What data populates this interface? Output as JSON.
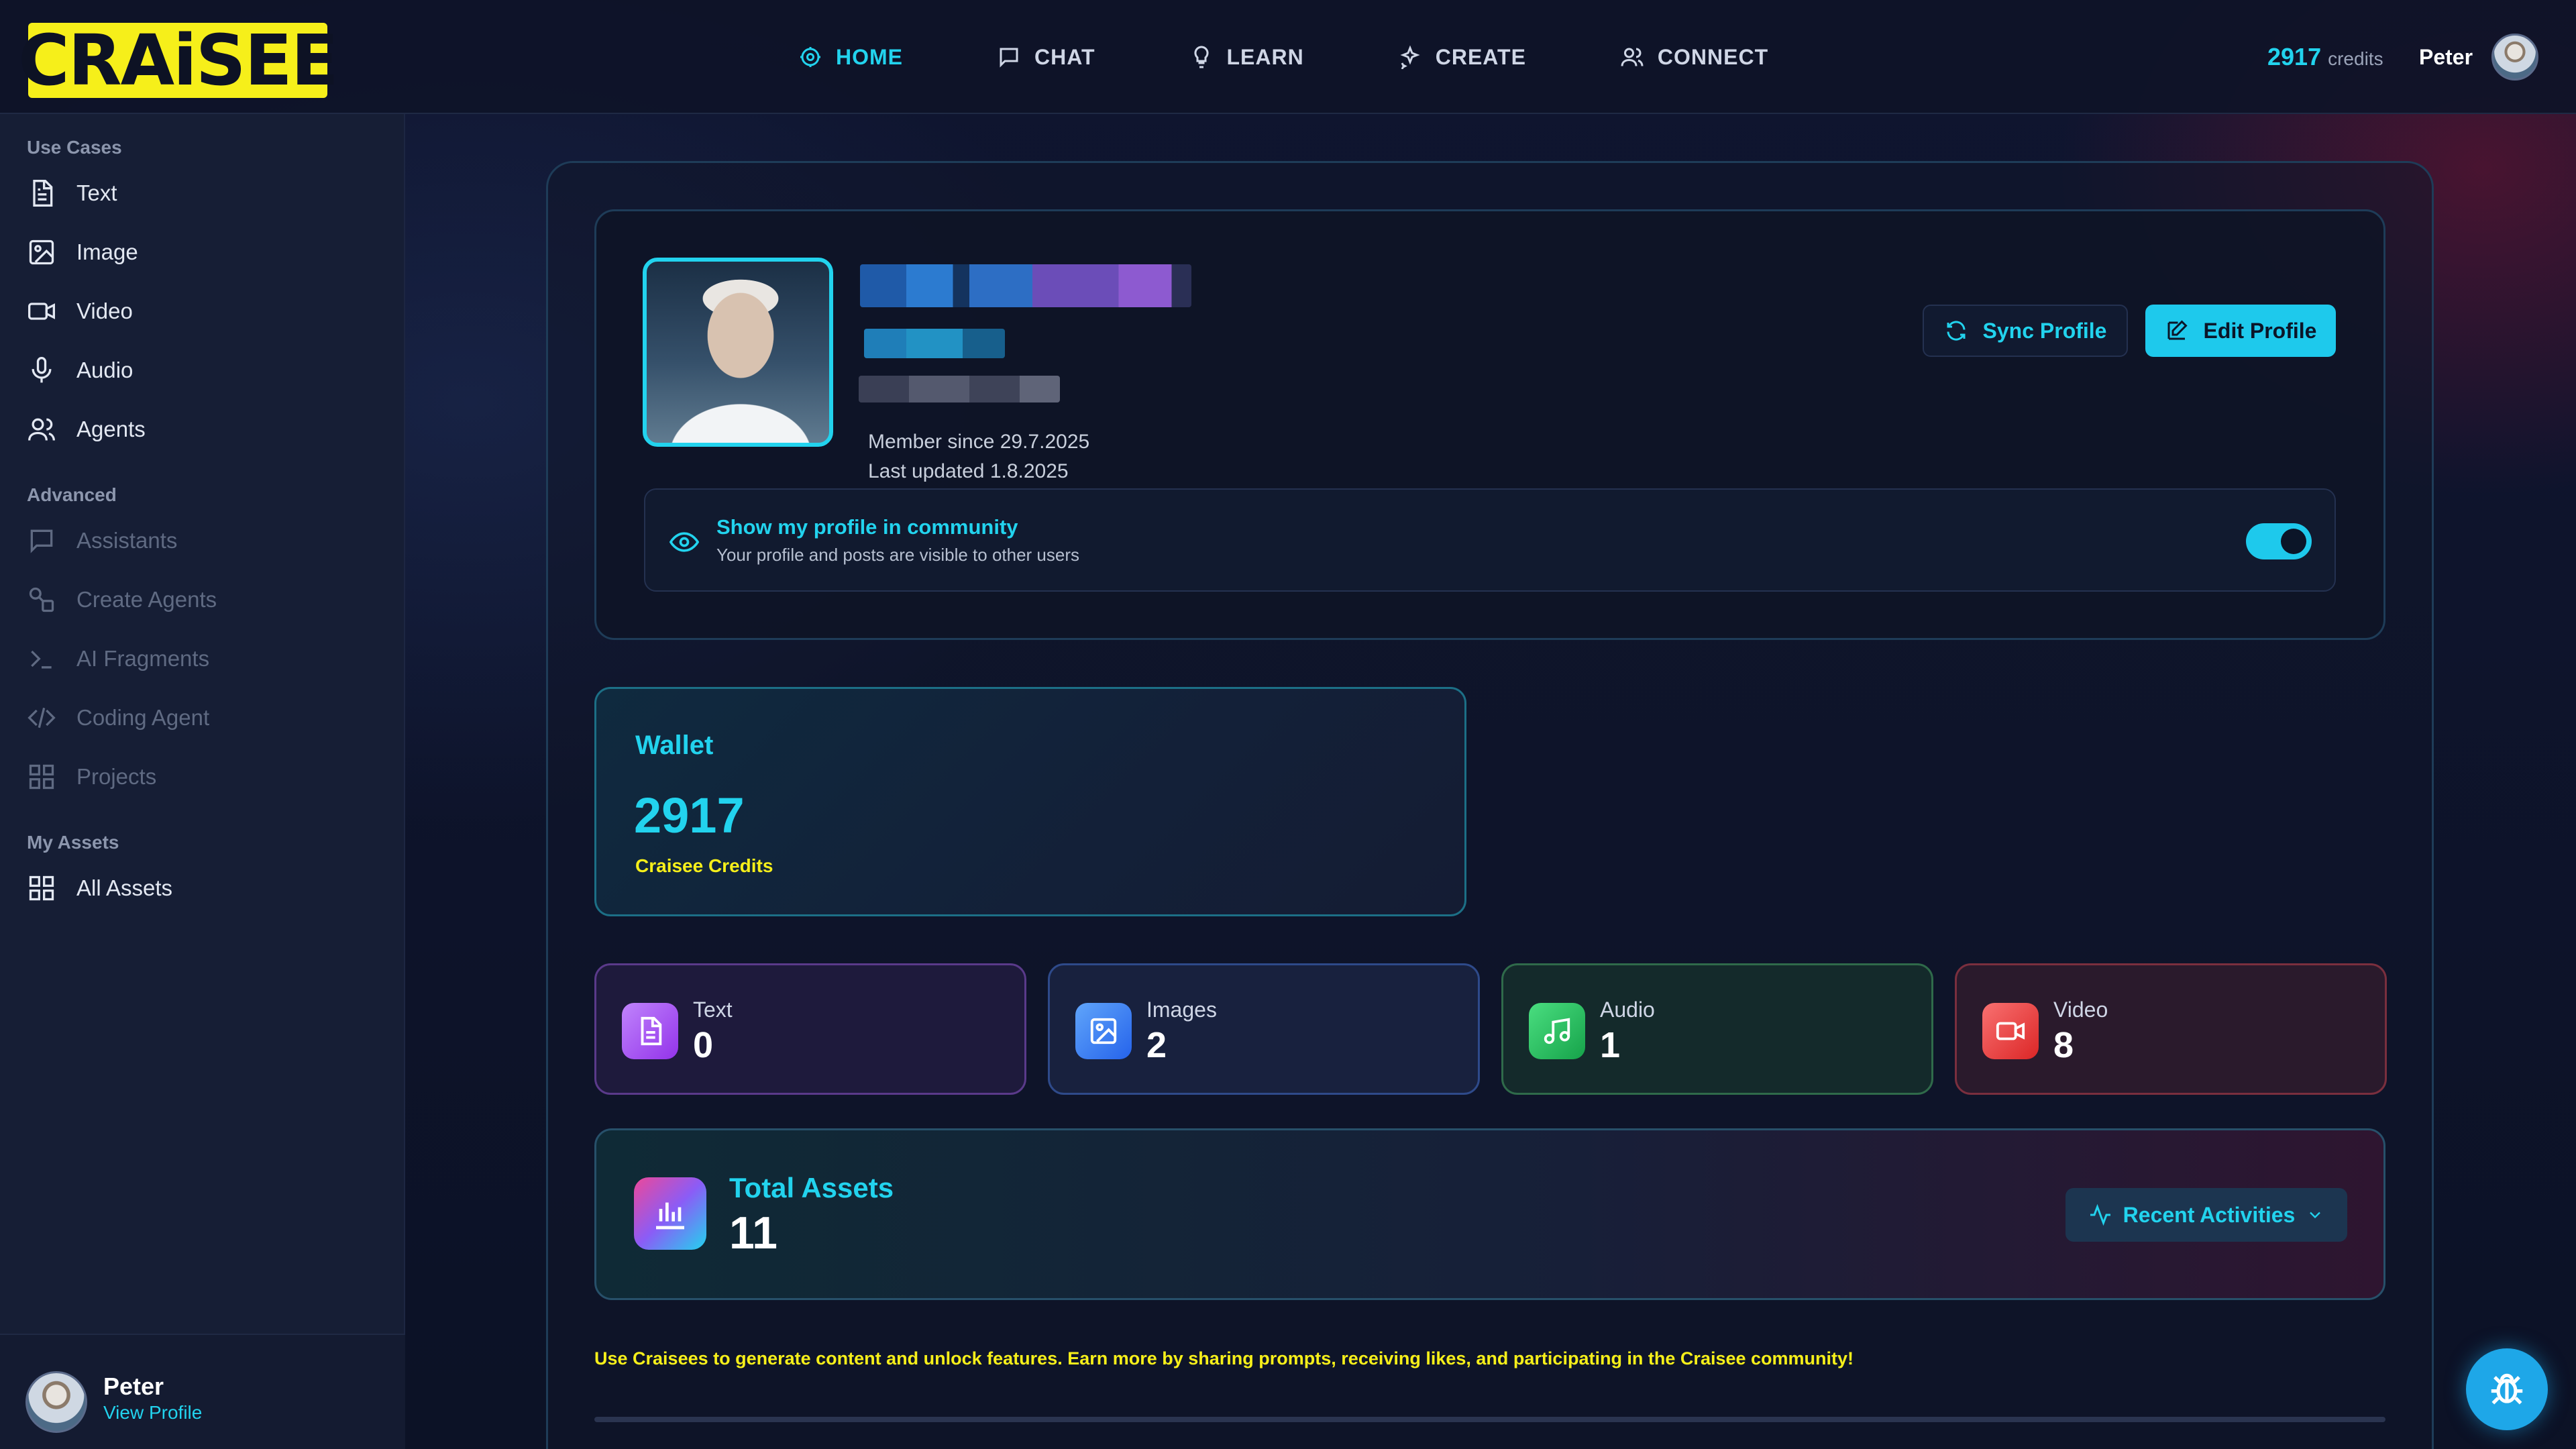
{
  "brand": {
    "logo_text": "CRAiSEE",
    "accent": "#22d3ee",
    "highlight": "#f6ef1a"
  },
  "nav": [
    {
      "label": "HOME",
      "icon": "home-icon",
      "active": true
    },
    {
      "label": "CHAT",
      "icon": "chat-icon"
    },
    {
      "label": "LEARN",
      "icon": "lightbulb-icon"
    },
    {
      "label": "CREATE",
      "icon": "sparkle-icon"
    },
    {
      "label": "CONNECT",
      "icon": "users-icon"
    }
  ],
  "header": {
    "credits": "2917",
    "credits_label": "credits",
    "user_name": "Peter"
  },
  "sidebar": {
    "sections": {
      "use_cases": "Use Cases",
      "advanced": "Advanced",
      "my_assets": "My Assets"
    },
    "use_cases": [
      "Text",
      "Image",
      "Video",
      "Audio",
      "Agents"
    ],
    "advanced": [
      "Assistants",
      "Create Agents",
      "AI Fragments",
      "Coding Agent",
      "Projects"
    ],
    "my_assets": [
      "All Assets"
    ],
    "footer": {
      "name": "Peter",
      "link": "View Profile"
    }
  },
  "profile": {
    "member_since": "Member since 29.7.2025",
    "last_updated": "Last updated 1.8.2025",
    "sync_label": "Sync Profile",
    "edit_label": "Edit Profile",
    "community_title": "Show my profile in community",
    "community_desc": "Your profile and posts are visible to other users",
    "community_enabled": true
  },
  "wallet": {
    "title": "Wallet",
    "amount": "2917",
    "label": "Craisee Credits"
  },
  "stats": [
    {
      "label": "Text",
      "value": "0",
      "icon": "document-icon",
      "color": "#a855f7"
    },
    {
      "label": "Images",
      "value": "2",
      "icon": "image-icon",
      "color": "#3b82f6"
    },
    {
      "label": "Audio",
      "value": "1",
      "icon": "music-icon",
      "color": "#22c55e"
    },
    {
      "label": "Video",
      "value": "8",
      "icon": "video-icon",
      "color": "#ef4444"
    }
  ],
  "total": {
    "title": "Total Assets",
    "value": "11",
    "recent_label": "Recent Activities"
  },
  "footnote": "Use Craisees to generate content and unlock features. Earn more by sharing prompts, receiving likes, and participating in the Craisee community!"
}
